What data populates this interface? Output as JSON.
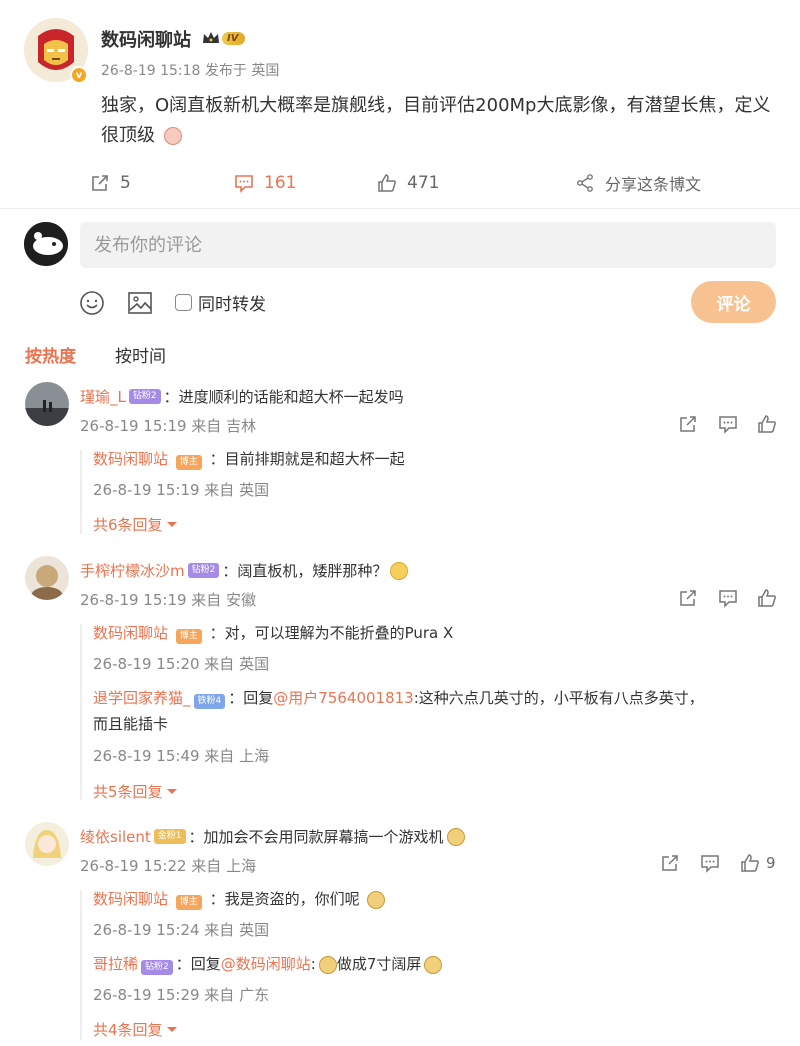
{
  "post": {
    "author": "数码闲聊站",
    "level_badge": "IV",
    "verified_mark": "v",
    "meta": "26-8-19 15:18 发布于 英国",
    "text": "独家，O阔直板新机大概率是旗舰线，目前评估200Mp大底影像，有潜望长焦，定义很顶级",
    "actions": {
      "repost_count": "5",
      "comment_count": "161",
      "like_count": "471",
      "share_label": "分享这条博文"
    }
  },
  "compose": {
    "placeholder": "发布你的评论",
    "repost_label": "同时转发",
    "submit_label": "评论"
  },
  "sort": {
    "hot": "按热度",
    "time": "按时间"
  },
  "comments": [
    {
      "user": "瑾瑜_L",
      "badge": "钻粉2",
      "text": "：进度顺利的话能和超大杯一起发吗",
      "meta": "26-8-19 15:19 来自 吉林",
      "likes": "",
      "replies": [
        {
          "user": "数码闲聊站",
          "badge": "博主",
          "text": "：目前排期就是和超大杯一起",
          "meta": "26-8-19 15:19 来自 英国"
        }
      ],
      "more": "共6条回复"
    },
    {
      "user": "手榨柠檬冰沙m",
      "badge": "钻粉2",
      "text": "：阔直板机，矮胖那种？",
      "meta": "26-8-19 15:19 来自 安徽",
      "likes": "",
      "replies": [
        {
          "user": "数码闲聊站",
          "badge": "博主",
          "text": "：对，可以理解为不能折叠的Pura X",
          "meta": "26-8-19 15:20 来自 英国"
        },
        {
          "user": "退学回家养猫_",
          "badge": "铁粉4",
          "prefix": "：回复",
          "mention": "@用户7564001813",
          "text": ":这种六点几英寸的，小平板有八点多英寸，",
          "text2": "而且能插卡",
          "meta": "26-8-19 15:49 来自 上海"
        }
      ],
      "more": "共5条回复"
    },
    {
      "user": "绫依silent",
      "badge": "金粉1",
      "text": "：加加会不会用同款屏幕搞一个游戏机",
      "meta": "26-8-19 15:22 来自 上海",
      "likes": "9",
      "replies": [
        {
          "user": "数码闲聊站",
          "badge": "博主",
          "text": "：我是资盗的，你们呢",
          "meta": "26-8-19 15:24 来自 英国"
        },
        {
          "user": "哥拉稀",
          "badge": "钻粉2",
          "prefix": "：回复",
          "mention": "@数码闲聊站",
          "text": ":",
          "text2": "做成7寸阔屏",
          "meta": "26-8-19 15:29 来自 广东"
        }
      ],
      "more": "共4条回复"
    }
  ],
  "colors": {
    "accent": "#eb7350",
    "submit_bg": "#f7c290"
  }
}
